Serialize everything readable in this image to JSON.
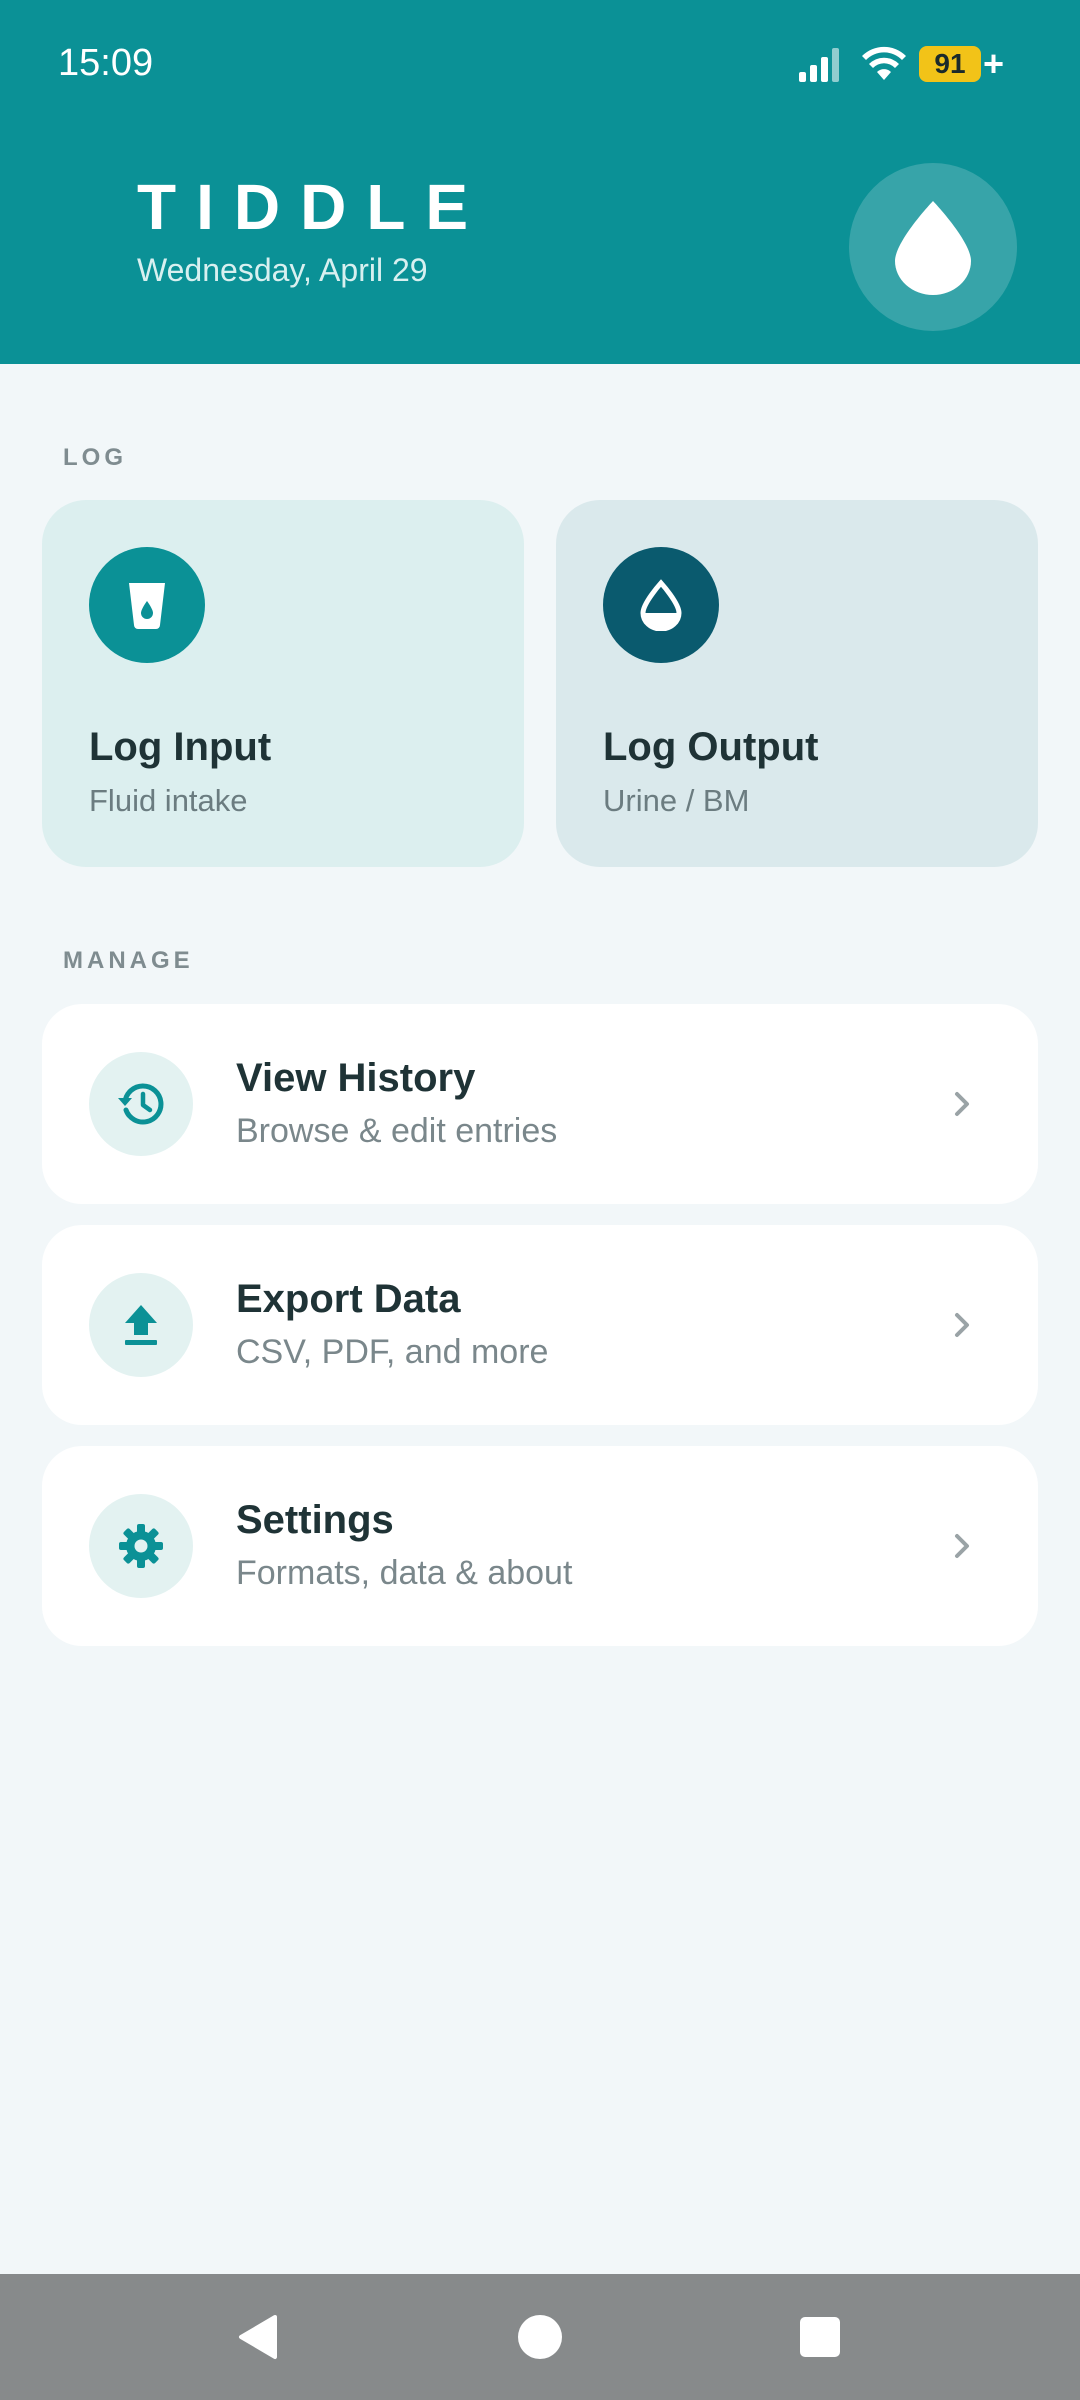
{
  "status_bar": {
    "time": "15:09",
    "battery": "91",
    "battery_suffix": "+",
    "icons": [
      "signal-icon",
      "wifi-icon",
      "battery-icon"
    ]
  },
  "header": {
    "title": "TIDDLE",
    "date": "Wednesday, April 29",
    "badge_icon": "water-drop-icon",
    "color": "#0b9196"
  },
  "log_section": {
    "label": "LOG",
    "cards": [
      {
        "title": "Log Input",
        "subtitle": "Fluid intake",
        "icon": "cup-icon",
        "color": "#0b9196"
      },
      {
        "title": "Log Output",
        "subtitle": "Urine / BM",
        "icon": "drop-outline-icon",
        "color": "#0a5a6e"
      }
    ]
  },
  "manage_section": {
    "label": "MANAGE",
    "items": [
      {
        "title": "View History",
        "subtitle": "Browse & edit entries",
        "icon": "history-icon"
      },
      {
        "title": "Export Data",
        "subtitle": "CSV, PDF, and more",
        "icon": "upload-icon"
      },
      {
        "title": "Settings",
        "subtitle": "Formats, data & about",
        "icon": "gear-icon"
      }
    ]
  },
  "nav_bar": {
    "buttons": [
      "back-icon",
      "home-icon",
      "recents-icon"
    ]
  }
}
